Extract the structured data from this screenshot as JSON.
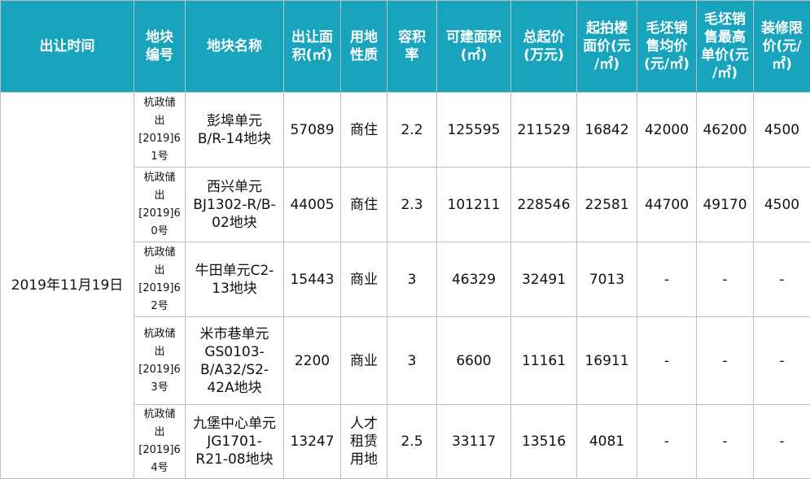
{
  "headers": [
    "出让时间",
    "地块\n编号",
    "地块名称",
    "出让面\n积(㎡)",
    "用地\n性质",
    "容积\n率",
    "可建面积\n(㎡)",
    "总起价\n(万元)",
    "起拍楼\n面价(元\n/㎡)",
    "毛坯销\n售均价\n(元/㎡)",
    "毛坯销\n售最高\n单价(元\n/㎡)",
    "装修限\n价(元/\n㎡)"
  ],
  "date": "2019年11月19日",
  "rows": [
    {
      "code": "杭政储\n出\n[2019]6\n1号",
      "name": "彭埠单元\nB/R-14地块",
      "area": "57089",
      "use": "商住",
      "far": "2.2",
      "buildable": "125595",
      "total": "211529",
      "floor_price": "16842",
      "avg_price": "42000",
      "max_price": "46200",
      "deco_limit": "4500"
    },
    {
      "code": "杭政储\n出\n[2019]6\n0号",
      "name": "西兴单元\nBJ1302-R/B-\n02地块",
      "area": "44005",
      "use": "商住",
      "far": "2.3",
      "buildable": "101211",
      "total": "228546",
      "floor_price": "22581",
      "avg_price": "44700",
      "max_price": "49170",
      "deco_limit": "4500"
    },
    {
      "code": "杭政储\n出\n[2019]6\n2号",
      "name": "牛田单元C2-\n13地块",
      "area": "15443",
      "use": "商业",
      "far": "3",
      "buildable": "46329",
      "total": "32491",
      "floor_price": "7013",
      "avg_price": "-",
      "max_price": "-",
      "deco_limit": "-"
    },
    {
      "code": "杭政储\n出\n[2019]6\n3号",
      "name": "米市巷单元\nGS0103-\nB/A32/S2-\n42A地块",
      "area": "2200",
      "use": "商业",
      "far": "3",
      "buildable": "6600",
      "total": "11161",
      "floor_price": "16911",
      "avg_price": "-",
      "max_price": "-",
      "deco_limit": "-"
    },
    {
      "code": "杭政储\n出\n[2019]6\n4号",
      "name": "九堡中心单元\nJG1701-\nR21-08地块",
      "area": "13247",
      "use": "人才\n租赁\n用地",
      "far": "2.5",
      "buildable": "33117",
      "total": "13516",
      "floor_price": "4081",
      "avg_price": "-",
      "max_price": "-",
      "deco_limit": "-"
    }
  ]
}
